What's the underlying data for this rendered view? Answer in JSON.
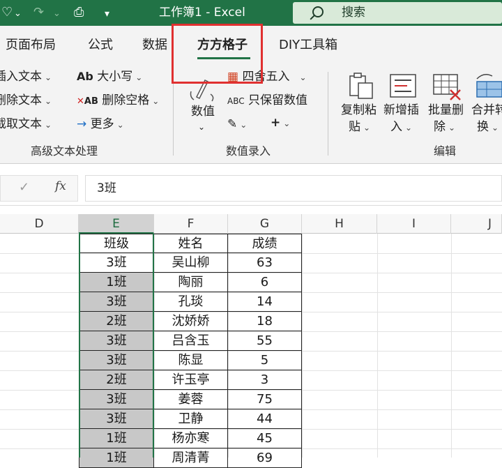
{
  "titlebar": {
    "title": "工作簿1  -  Excel",
    "search_placeholder": "搜索"
  },
  "tabs": [
    "页面布局",
    "公式",
    "数据",
    "方方格子",
    "DIY工具箱"
  ],
  "ribbon": {
    "group_text": {
      "label": "高级文本处理",
      "items": [
        "插入文本",
        "删除文本",
        "截取文本"
      ],
      "items2": [
        "大小写",
        "删除空格",
        "更多"
      ]
    },
    "group_number": {
      "label": "数值录入",
      "big_button": "数值",
      "items": [
        "四舍五入",
        "只保留数值"
      ]
    },
    "group_edit": {
      "label": "编辑",
      "buttons": [
        {
          "line1": "复制粘",
          "line2": "贴"
        },
        {
          "line1": "新增插",
          "line2": "入"
        },
        {
          "line1": "批量删",
          "line2": "除"
        },
        {
          "line1": "合并转",
          "line2": "换"
        }
      ]
    }
  },
  "formula_bar": {
    "value": "3班"
  },
  "columns": [
    "D",
    "E",
    "F",
    "G",
    "H",
    "I",
    "J"
  ],
  "table": {
    "headers": [
      "班级",
      "姓名",
      "成绩"
    ],
    "rows": [
      [
        "3班",
        "吴山柳",
        "63"
      ],
      [
        "1班",
        "陶丽",
        "6"
      ],
      [
        "3班",
        "孔琰",
        "14"
      ],
      [
        "2班",
        "沈娇娇",
        "18"
      ],
      [
        "3班",
        "吕含玉",
        "55"
      ],
      [
        "3班",
        "陈显",
        "5"
      ],
      [
        "2班",
        "许玉亭",
        "3"
      ],
      [
        "3班",
        "姜蓉",
        "75"
      ],
      [
        "3班",
        "卫静",
        "44"
      ],
      [
        "1班",
        "杨亦寒",
        "45"
      ],
      [
        "1班",
        "周清菁",
        "69"
      ]
    ]
  }
}
